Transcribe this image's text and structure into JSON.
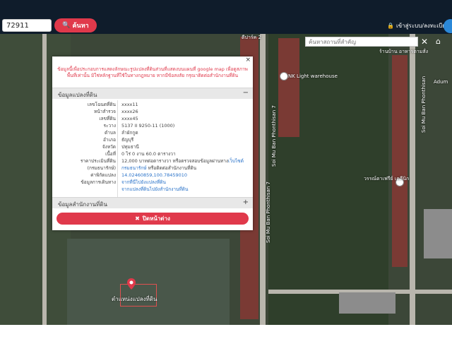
{
  "search": {
    "value": "72911",
    "button_label": "ค้นหา"
  },
  "auth": {
    "login_label": "เข้าสู่ระบบ/ลงทะเบียน"
  },
  "map": {
    "place_search_placeholder": "ค้นหาสถานที่สำคัญ",
    "road_labels": [
      "Soi Mu Ban Phonthisan 7",
      "Soi Mu Ban Phonthisan 7",
      "Soi Mu Ban Phonthisan"
    ],
    "pois": [
      "NK Light warehouse",
      "ร้านบ้าน อาหารตามสั่ง",
      "วรรณ์ดาเฟรีย์ เคลีนิก",
      "Adum",
      "ดีปาร์ค 2"
    ],
    "marker_label": "ตำแหน่งแปลงที่ดิน"
  },
  "panel": {
    "notice": "ข้อมูลนี้เพื่อประกอบการแสดงลักษณะรูปแปลงที่ดินส่วนที่แสดงบนแผนที่ google map เพื่อดูสภาพพื้นที่เท่านั้น มิใช่หลักฐานที่ใช้ในทางกฎหมาย หากมีข้อสงสัย กรุณาติดต่อสำนักงานที่ดิน",
    "section_land": "ข้อมูลแปลงที่ดิน",
    "section_office": "ข้อมูลสำนักงานที่ดิน",
    "close_label": "ปิดหน้าต่าง",
    "rows": [
      {
        "label": "เลขโฉนดที่ดิน",
        "value": "xxxx11"
      },
      {
        "label": "หน้าสำรวจ",
        "value": "xxxx26"
      },
      {
        "label": "เลขที่ดิน",
        "value": "xxxx45"
      },
      {
        "label": "ระวาง",
        "value": "5137 II 9250-11 (1000)"
      },
      {
        "label": "ตำบล",
        "value": "ลำผักกูด"
      },
      {
        "label": "อำเภอ",
        "value": "ธัญบุรี"
      },
      {
        "label": "จังหวัด",
        "value": "ปทุมธานี"
      },
      {
        "label": "เนื้อที่",
        "value": "0 ไร่ 0 งาน 60.0 ตารางวา"
      },
      {
        "label": "ราคาประเมินที่ดิน",
        "value": "12,000 บาทต่อตารางวา หรือตรวจสอบข้อมูลผ่านทาง",
        "link": "เว็บไซต์"
      },
      {
        "label": "(กรมธนารักษ์)",
        "value": "",
        "link": "กรมธนารักษ์",
        "suffix": " หรือติดต่อสำนักงานที่ดิน"
      },
      {
        "label": "ค่าพิกัดแปลง",
        "value": "",
        "link": "14.02460859,100.78459010"
      },
      {
        "label": "ข้อมูลการเดินทาง",
        "value": "",
        "link": "จากที่นี่ไปยังแปลงที่ดิน"
      },
      {
        "label": "",
        "value": "",
        "link": "จากแปลงที่ดินไปยังสำนักงานที่ดิน"
      }
    ]
  },
  "colors": {
    "accent": "#e0394b",
    "topbar": "#0f1c2b",
    "link": "#2a73c9"
  }
}
